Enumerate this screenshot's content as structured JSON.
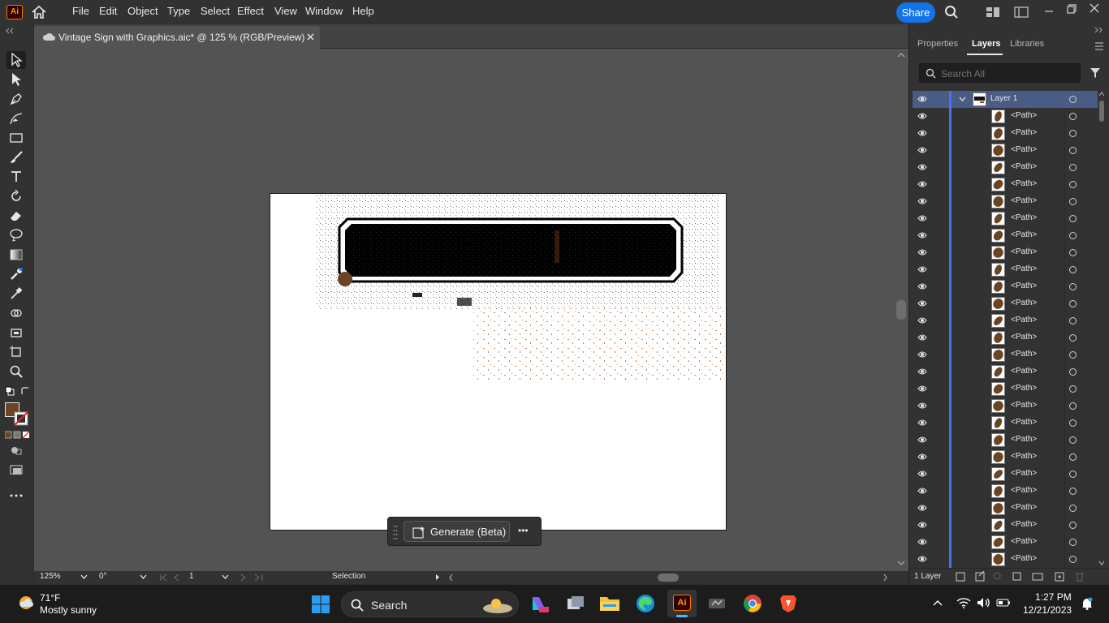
{
  "app": {
    "logo_text": "Ai",
    "menus": [
      "File",
      "Edit",
      "Object",
      "Type",
      "Select",
      "Effect",
      "View",
      "Window",
      "Help"
    ],
    "share_label": "Share"
  },
  "document": {
    "tab_title": "Vintage Sign with Graphics.aic* @ 125 % (RGB/Preview)"
  },
  "tools": [
    "selection-tool",
    "direct-selection-tool",
    "pen-tool",
    "curvature-tool",
    "rectangle-tool",
    "paintbrush-tool",
    "type-tool",
    "rotate-tool",
    "eraser-tool",
    "lasso-tool",
    "gradient-tool",
    "puppet-warp-tool",
    "eyedropper-tool",
    "blend-tool",
    "shape-builder-tool",
    "artboard-tool",
    "zoom-tool"
  ],
  "colors": {
    "fill": "#6b4423",
    "accent": "#1473e6",
    "layer_blue": "#4b71e6"
  },
  "status": {
    "zoom": "125%",
    "rotation": "0°",
    "artboard": "1",
    "tool_label": "Selection"
  },
  "generate": {
    "label": "Generate (Beta)",
    "more": "•••"
  },
  "panel": {
    "tabs": [
      "Properties",
      "Layers",
      "Libraries"
    ],
    "search_placeholder": "Search All",
    "layer_name": "Layer 1",
    "path_label": "<Path>",
    "path_count": 27,
    "footer_text": "1 Layer"
  },
  "taskbar": {
    "temp": "71°F",
    "weather": "Mostly sunny",
    "search_label": "Search",
    "time": "1:27 PM",
    "date": "12/21/2023"
  }
}
